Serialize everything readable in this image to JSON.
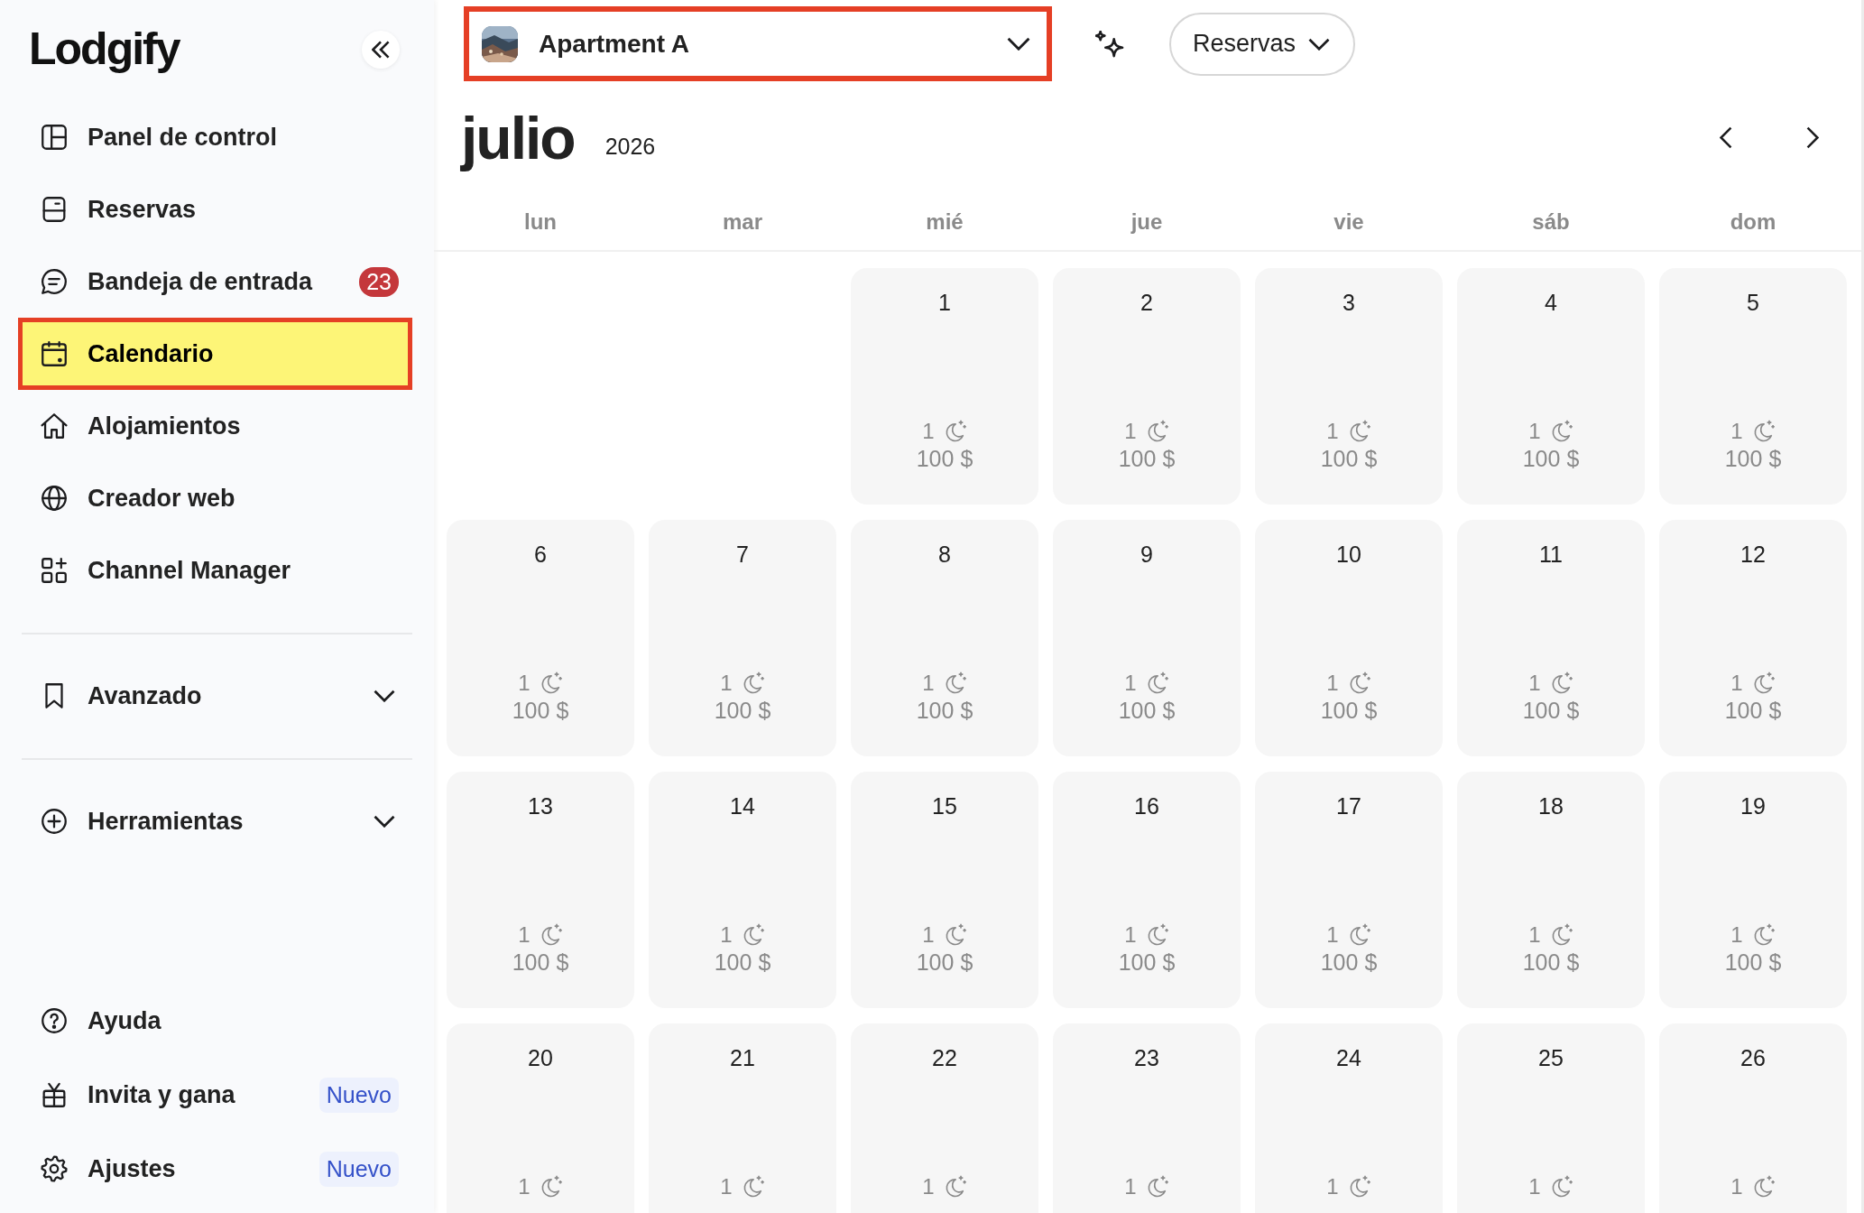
{
  "sidebar": {
    "logo": "Lodgify",
    "main_items": [
      {
        "label": "Panel de control",
        "selected": false
      },
      {
        "label": "Reservas",
        "selected": false
      },
      {
        "label": "Bandeja de entrada",
        "selected": false,
        "count": "23"
      },
      {
        "label": "Calendario",
        "selected": true
      },
      {
        "label": "Alojamientos",
        "selected": false
      },
      {
        "label": "Creador web",
        "selected": false
      },
      {
        "label": "Channel Manager",
        "selected": false
      }
    ],
    "expandable_items": [
      {
        "label": "Avanzado",
        "expanded": false
      },
      {
        "label": "Herramientas",
        "expanded": false
      }
    ],
    "footer_items": [
      {
        "label": "Ayuda"
      },
      {
        "label": "Invita y gana",
        "tag": "Nuevo"
      },
      {
        "label": "Ajustes",
        "tag": "Nuevo"
      }
    ]
  },
  "header": {
    "property_selector": {
      "value": "Apartment A",
      "highlighted": true
    },
    "view_selector": {
      "value": "Reservas"
    }
  },
  "calendar": {
    "month": "julio",
    "year": "2026",
    "weekdays": [
      "lun",
      "mar",
      "mié",
      "jue",
      "vie",
      "sáb",
      "dom"
    ],
    "weeks": [
      [
        {
          "kind": "empty"
        },
        {
          "kind": "empty"
        },
        {
          "kind": "day",
          "day": "1",
          "nights": "1",
          "price": "100 $"
        },
        {
          "kind": "day",
          "day": "2",
          "nights": "1",
          "price": "100 $"
        },
        {
          "kind": "day",
          "day": "3",
          "nights": "1",
          "price": "100 $"
        },
        {
          "kind": "day",
          "day": "4",
          "nights": "1",
          "price": "100 $"
        },
        {
          "kind": "day",
          "day": "5",
          "nights": "1",
          "price": "100 $"
        }
      ],
      [
        {
          "kind": "day",
          "day": "6",
          "nights": "1",
          "price": "100 $"
        },
        {
          "kind": "day",
          "day": "7",
          "nights": "1",
          "price": "100 $"
        },
        {
          "kind": "day",
          "day": "8",
          "nights": "1",
          "price": "100 $"
        },
        {
          "kind": "day",
          "day": "9",
          "nights": "1",
          "price": "100 $"
        },
        {
          "kind": "day",
          "day": "10",
          "nights": "1",
          "price": "100 $"
        },
        {
          "kind": "day",
          "day": "11",
          "nights": "1",
          "price": "100 $"
        },
        {
          "kind": "day",
          "day": "12",
          "nights": "1",
          "price": "100 $"
        }
      ],
      [
        {
          "kind": "day",
          "day": "13",
          "nights": "1",
          "price": "100 $"
        },
        {
          "kind": "day",
          "day": "14",
          "nights": "1",
          "price": "100 $"
        },
        {
          "kind": "day",
          "day": "15",
          "nights": "1",
          "price": "100 $"
        },
        {
          "kind": "day",
          "day": "16",
          "nights": "1",
          "price": "100 $"
        },
        {
          "kind": "day",
          "day": "17",
          "nights": "1",
          "price": "100 $"
        },
        {
          "kind": "day",
          "day": "18",
          "nights": "1",
          "price": "100 $"
        },
        {
          "kind": "day",
          "day": "19",
          "nights": "1",
          "price": "100 $"
        }
      ],
      [
        {
          "kind": "day",
          "day": "20",
          "nights": "1"
        },
        {
          "kind": "day",
          "day": "21",
          "nights": "1"
        },
        {
          "kind": "day",
          "day": "22",
          "nights": "1"
        },
        {
          "kind": "day",
          "day": "23",
          "nights": "1"
        },
        {
          "kind": "day",
          "day": "24",
          "nights": "1"
        },
        {
          "kind": "day",
          "day": "25",
          "nights": "1"
        },
        {
          "kind": "day",
          "day": "26",
          "nights": "1"
        }
      ]
    ]
  }
}
